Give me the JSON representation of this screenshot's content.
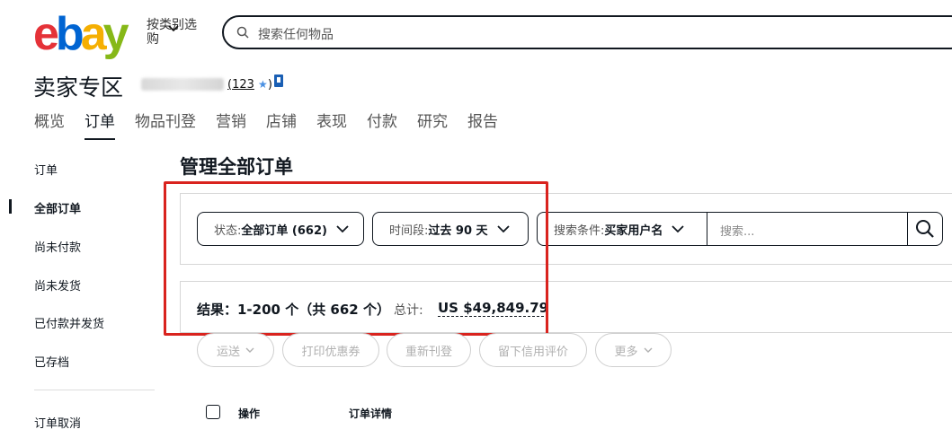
{
  "header": {
    "logo_letters": [
      "e",
      "b",
      "a",
      "y"
    ],
    "logo_colors": [
      "#e53238",
      "#0064d2",
      "#f5af02",
      "#86b817"
    ],
    "category_label": "按类别选购",
    "search_placeholder": "搜索任何物品"
  },
  "hub": {
    "title": "卖家专区",
    "feedback_score": "123",
    "open_paren": "(",
    "close_paren": ")",
    "star": "★"
  },
  "nav": {
    "items": [
      {
        "label": "概览"
      },
      {
        "label": "订单"
      },
      {
        "label": "物品刊登"
      },
      {
        "label": "营销"
      },
      {
        "label": "店铺"
      },
      {
        "label": "表现"
      },
      {
        "label": "付款"
      },
      {
        "label": "研究"
      },
      {
        "label": "报告"
      }
    ],
    "active_index": 1
  },
  "sidebar": {
    "items": [
      {
        "label": "订单"
      },
      {
        "label": "全部订单"
      },
      {
        "label": "尚未付款"
      },
      {
        "label": "尚未发货"
      },
      {
        "label": "已付款并发货"
      },
      {
        "label": "已存档"
      },
      {
        "label": "订单取消"
      }
    ],
    "active_index": 1
  },
  "main": {
    "page_title": "管理全部订单",
    "filters": {
      "status_key": "状态:",
      "status_value": "全部订单 (662)",
      "period_key": "时间段:",
      "period_value": "过去 90 天",
      "criteria_key": "搜索条件:",
      "criteria_value": "买家用户名",
      "search_placeholder": "搜索..."
    },
    "results": {
      "summary": "结果：1-200 个（共 662 个）",
      "total_label": "总计:",
      "total_value": "US $49,849.79"
    },
    "actions": [
      {
        "label": "运送",
        "has_dropdown": true
      },
      {
        "label": "打印优惠券",
        "has_dropdown": false
      },
      {
        "label": "重新刊登",
        "has_dropdown": false
      },
      {
        "label": "留下信用评价",
        "has_dropdown": false
      },
      {
        "label": "更多",
        "has_dropdown": true
      }
    ],
    "table_headers": {
      "actions": "操作",
      "order_details": "订单详情"
    }
  },
  "colors": {
    "highlight_border": "#d9231e",
    "text_primary": "#111820",
    "disabled_text": "#b0b0b0"
  }
}
